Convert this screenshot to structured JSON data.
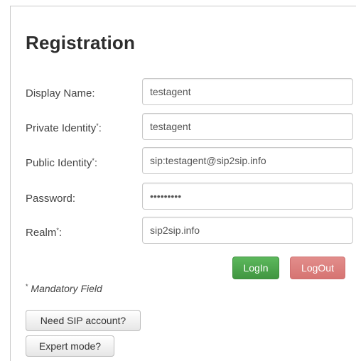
{
  "title": "Registration",
  "form": {
    "display_name": {
      "label": "Display Name:",
      "value": "testagent"
    },
    "private_identity": {
      "label": "Private Identity",
      "required_mark": "*",
      "suffix": ":",
      "value": "testagent"
    },
    "public_identity": {
      "label": "Public Identity",
      "required_mark": "*",
      "suffix": ":",
      "value": "sip:testagent@sip2sip.info"
    },
    "password": {
      "label": "Password:",
      "value": "•••••••••"
    },
    "realm": {
      "label": "Realm",
      "required_mark": "*",
      "suffix": ":",
      "value": "sip2sip.info"
    }
  },
  "actions": {
    "login_label": "LogIn",
    "logout_label": "LogOut"
  },
  "mandatory_note": {
    "mark": "*",
    "text": " Mandatory Field"
  },
  "links": {
    "need_account_label": "Need SIP account?",
    "expert_mode_label": "Expert mode?"
  },
  "colors": {
    "login": "#49a749",
    "logout": "#db7f7d"
  }
}
